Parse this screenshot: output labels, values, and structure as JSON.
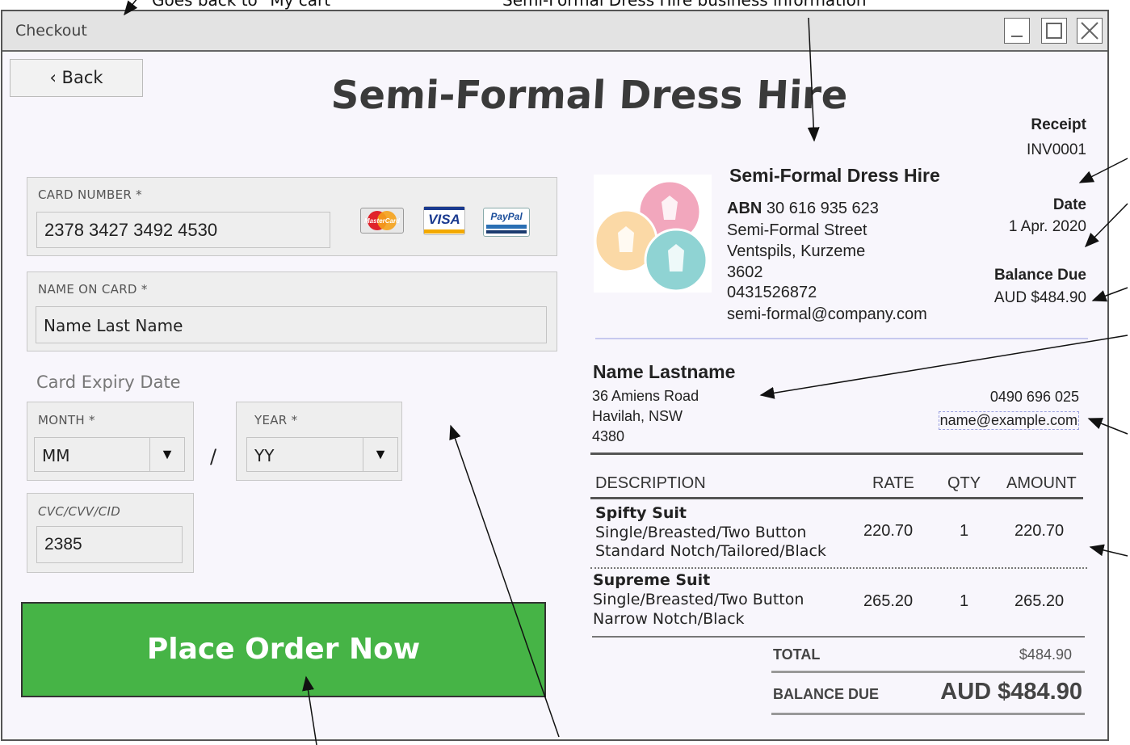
{
  "annotations": {
    "back_note": "Goes back to \"My cart\"",
    "business_note": "Semi-Formal Dress Hire business information"
  },
  "window": {
    "title": "Checkout",
    "controls": [
      "minimize-icon",
      "maximize-icon",
      "close-icon"
    ]
  },
  "back_button": {
    "label": "‹ Back"
  },
  "store_title": "Semi-Formal Dress Hire",
  "payment_form": {
    "card_number": {
      "label": "CARD NUMBER *",
      "value": "2378 3427 3492 4530"
    },
    "card_logos": [
      "MasterCard",
      "VISA",
      "PayPal"
    ],
    "name_on_card": {
      "label": "NAME ON CARD *",
      "value": "Name Last Name"
    },
    "expiry": {
      "heading": "Card Expiry Date",
      "month": {
        "label": "MONTH *",
        "value": "MM"
      },
      "separator": "/",
      "year": {
        "label": "YEAR *",
        "value": "YY"
      }
    },
    "cvc": {
      "label": "CVC/CVV/CID",
      "value": "2385"
    },
    "submit_label": "Place Order Now"
  },
  "receipt": {
    "business": {
      "name": "Semi-Formal Dress Hire",
      "abn_label": "ABN",
      "abn": "30 616 935 623",
      "street": "Semi-Formal Street",
      "city": "Ventspils, Kurzeme",
      "postcode": "3602",
      "phone": "0431526872",
      "email": "semi-formal@company.com"
    },
    "meta": {
      "receipt_label": "Receipt",
      "receipt_number": "INV0001",
      "date_label": "Date",
      "date": "1 Apr. 2020",
      "balance_due_label": "Balance Due",
      "balance_due": "AUD $484.90"
    },
    "customer": {
      "name": "Name Lastname",
      "street": "36 Amiens Road",
      "suburb": "Havilah, NSW",
      "postcode": "4380",
      "phone": "0490 696 025",
      "email": "name@example.com"
    },
    "table": {
      "headers": [
        "DESCRIPTION",
        "RATE",
        "QTY",
        "AMOUNT"
      ],
      "rows": [
        {
          "title": "Spifty Suit",
          "line1": "Single/Breasted/Two Button",
          "line2": "Standard Notch/Tailored/Black",
          "rate": "220.70",
          "qty": "1",
          "amount": "220.70"
        },
        {
          "title": "Supreme Suit",
          "line1": "Single/Breasted/Two Button",
          "line2": "Narrow Notch/Black",
          "rate": "265.20",
          "qty": "1",
          "amount": "265.20"
        }
      ]
    },
    "totals": {
      "total_label": "TOTAL",
      "total": "$484.90",
      "balance_due_label": "BALANCE DUE",
      "balance_due": "AUD $484.90"
    }
  }
}
